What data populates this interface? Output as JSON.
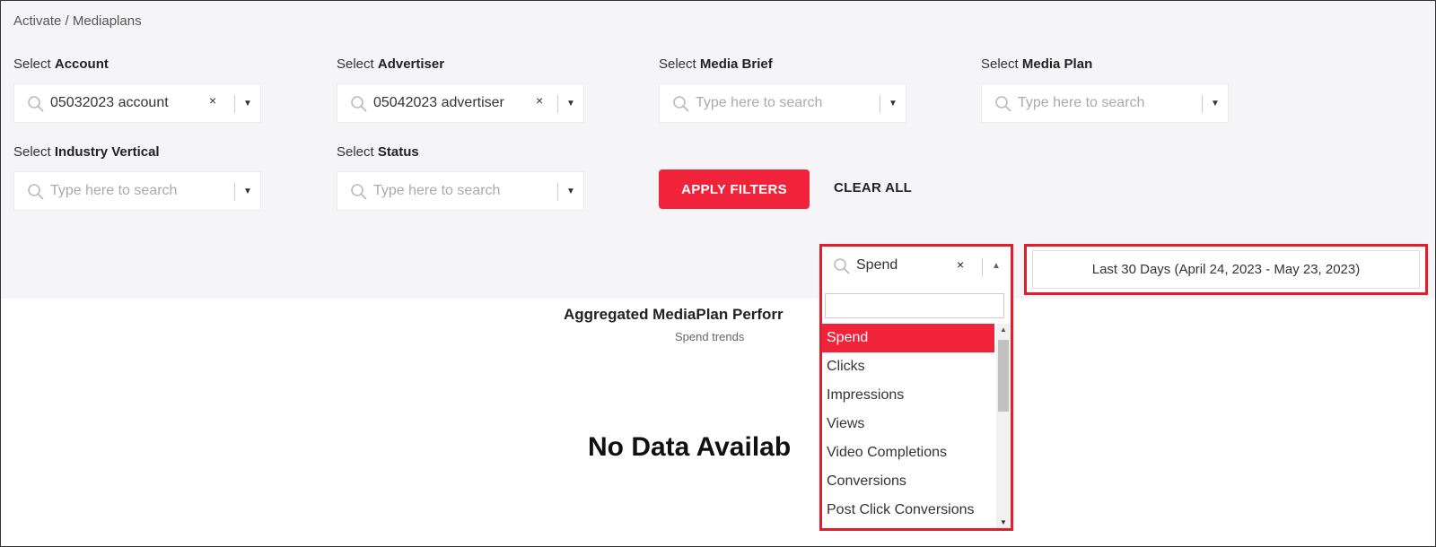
{
  "breadcrumb": "Activate / Mediaplans",
  "filters": [
    {
      "label_prefix": "Select",
      "label": "Account",
      "value": "05032023 account",
      "placeholder": "",
      "has_clear": true
    },
    {
      "label_prefix": "Select",
      "label": "Advertiser",
      "value": "05042023 advertiser",
      "placeholder": "",
      "has_clear": true
    },
    {
      "label_prefix": "Select",
      "label": "Media Brief",
      "value": "",
      "placeholder": "Type here to search",
      "has_clear": false
    },
    {
      "label_prefix": "Select",
      "label": "Media Plan",
      "value": "",
      "placeholder": "Type here to search",
      "has_clear": false
    },
    {
      "label_prefix": "Select",
      "label": "Industry Vertical",
      "value": "",
      "placeholder": "Type here to search",
      "has_clear": false
    },
    {
      "label_prefix": "Select",
      "label": "Status",
      "value": "",
      "placeholder": "Type here to search",
      "has_clear": false
    }
  ],
  "icons": {
    "search": "search-icon",
    "clear": "×",
    "dropdown": "▼",
    "dropup": "▲"
  },
  "actions": {
    "apply": "APPLY FILTERS",
    "clear_all": "CLEAR ALL"
  },
  "metric_select": {
    "value": "Spend",
    "search_value": "",
    "options": [
      "Spend",
      "Clicks",
      "Impressions",
      "Views",
      "Video Completions",
      "Conversions",
      "Post Click Conversions"
    ],
    "selected_index": 0
  },
  "date_range": "Last 30 Days (April 24, 2023 - May 23, 2023)",
  "chart": {
    "title": "Aggregated MediaPlan Perforr",
    "subtitle": "Spend trends",
    "empty_message": "No Data Availab"
  },
  "colors": {
    "accent": "#f0233b",
    "highlight_border": "#e31d2c"
  }
}
